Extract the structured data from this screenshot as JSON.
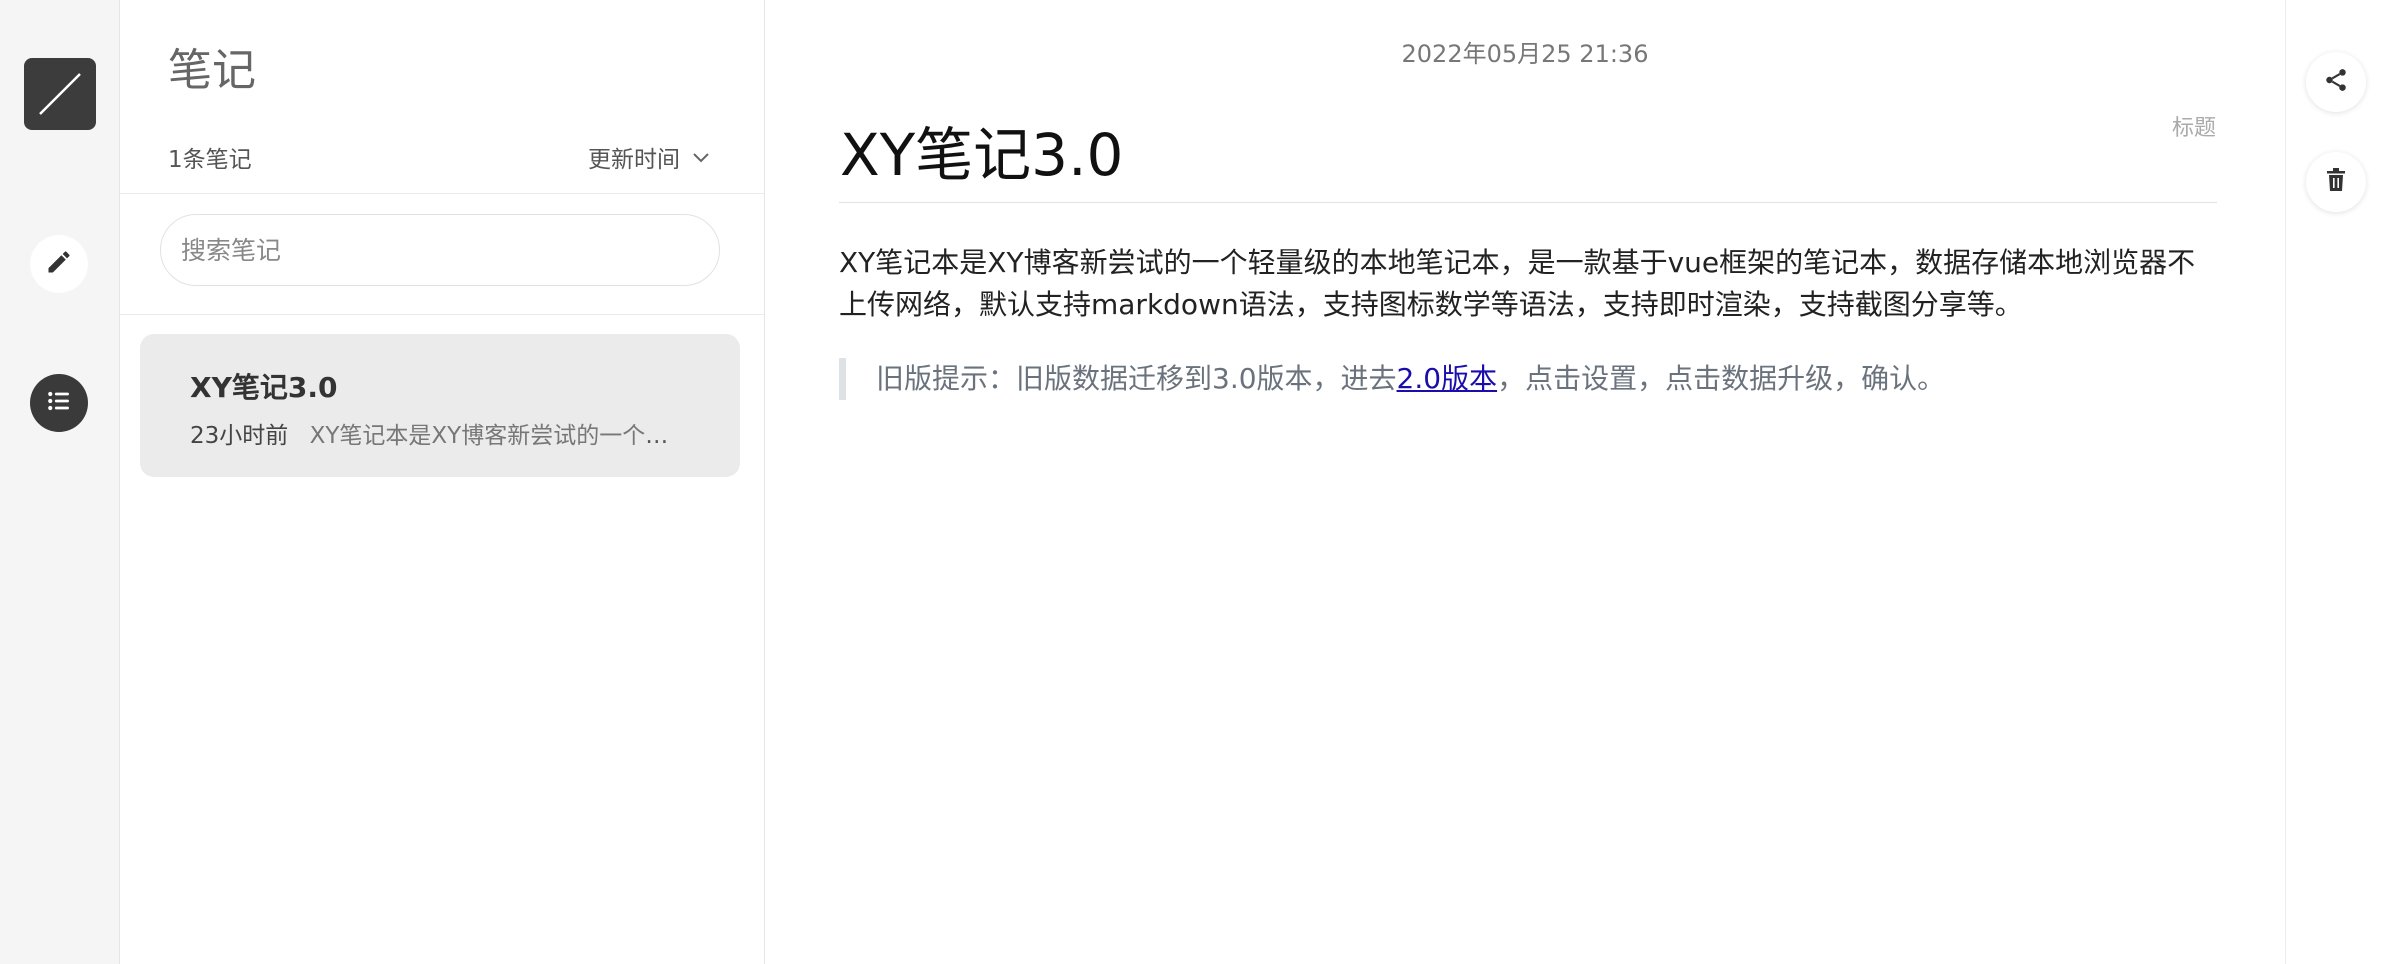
{
  "rail": {
    "logo_icon": "slash-logo-icon",
    "edit_icon": "pencil-icon",
    "list_icon": "list-icon"
  },
  "panel": {
    "title": "笔记",
    "count": "1条笔记",
    "sort_label": "更新时间",
    "search_placeholder": "搜索笔记",
    "notes": [
      {
        "title": "XY笔记3.0",
        "time": "23小时前",
        "snippet": "XY笔记本是XY博客新尝试的一个轻量级的本地笔记本，是一款基于vue框架的笔记本"
      }
    ]
  },
  "editor": {
    "date": "2022年05月25 21:36",
    "title_hint": "标题",
    "title": "XY笔记3.0",
    "body": "XY笔记本是XY博客新尝试的一个轻量级的本地笔记本，是一款基于vue框架的笔记本，数据存储本地浏览器不上传网络，默认支持markdown语法，支持图标数学等语法，支持即时渲染，支持截图分享等。",
    "quote_before": "旧版提示：旧版数据迁移到3.0版本，进去",
    "quote_link": "2.0版本",
    "quote_after": "，点击设置，点击数据升级，确认。"
  },
  "actions": {
    "share_icon": "share-icon",
    "trash_icon": "trash-icon"
  },
  "colors": {
    "rail_bg": "#f5f5f5",
    "selected_item_bg": "#ebebeb",
    "dark_button": "#3a3a3a",
    "link": "#1a0dab"
  }
}
